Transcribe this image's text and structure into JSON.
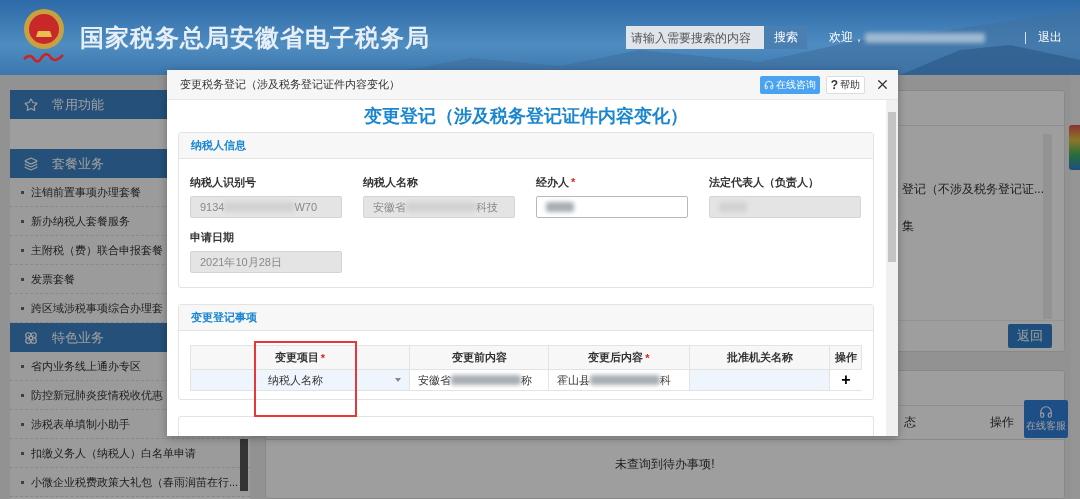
{
  "header": {
    "site_title": "国家税务总局安徽省电子税务局",
    "search": {
      "placeholder": "请输入需要搜索的内容",
      "button": "搜索"
    },
    "welcome": "欢迎，",
    "logout": "退出"
  },
  "sidebar": {
    "sections": [
      {
        "title": "常用功能"
      },
      {
        "title": "套餐业务",
        "items": [
          "注销前置事项办理套餐",
          "新办纳税人套餐服务",
          "主附税（费）联合申报套餐",
          "发票套餐",
          "跨区域涉税事项综合办理套"
        ]
      },
      {
        "title": "特色业务",
        "items": [
          "省内业务线上通办专区",
          "防控新冠肺炎疫情税收优惠",
          "涉税表单填制小助手",
          "扣缴义务人（纳税人）白名单申请",
          "小微企业税费政策大礼包（春雨润苗在行..."
        ]
      }
    ]
  },
  "background": {
    "panel_items": [
      "登记（不涉及税务登记证...",
      "集"
    ],
    "back_button": "返回",
    "table_headers": [
      "态",
      "操作"
    ],
    "empty_message": "未查询到待办事项!"
  },
  "float_button": "在线客服",
  "dialog": {
    "title": "变更税务登记（涉及税务登记证件内容变化）",
    "consult_button": "在线咨询",
    "help_button": {
      "glyph": "?",
      "label": "帮助"
    },
    "heading": "变更登记（涉及税务登记证件内容变化）",
    "required_mark": "*",
    "taxpayer_info": {
      "title": "纳税人信息",
      "fields": [
        {
          "label": "纳税人识别号",
          "required": false,
          "disabled": true,
          "value": [
            {
              "kind": "text",
              "text": "9134"
            },
            {
              "kind": "blur"
            },
            {
              "kind": "text",
              "text": "W70"
            }
          ]
        },
        {
          "label": "纳税人名称",
          "required": false,
          "disabled": true,
          "value": [
            {
              "kind": "text",
              "text": "安徽省"
            },
            {
              "kind": "blur"
            },
            {
              "kind": "text",
              "text": "科技"
            }
          ]
        },
        {
          "label": "经办人",
          "required": true,
          "disabled": false,
          "value": [
            {
              "kind": "blur"
            }
          ]
        },
        {
          "label": "法定代表人（负责人）",
          "required": false,
          "disabled": true,
          "value": [
            {
              "kind": "blur"
            }
          ]
        },
        {
          "label": "申请日期",
          "required": false,
          "disabled": true,
          "value": [
            {
              "kind": "text",
              "text": "2021年10月28日"
            }
          ]
        }
      ]
    },
    "change_items": {
      "title": "变更登记事项",
      "columns": [
        {
          "label": "变更项目",
          "required": true,
          "highlighted": true
        },
        {
          "label": "变更前内容",
          "required": false,
          "highlighted": false
        },
        {
          "label": "变更后内容",
          "required": true,
          "highlighted": false
        },
        {
          "label": "批准机关名称",
          "required": false,
          "highlighted": false
        },
        {
          "label": "操作",
          "required": false,
          "highlighted": false
        }
      ],
      "rows": [
        {
          "item": "纳税人名称",
          "before": [
            {
              "kind": "text",
              "text": "安徽省"
            },
            {
              "kind": "blur"
            },
            {
              "kind": "text",
              "text": "称"
            }
          ],
          "after": [
            {
              "kind": "text",
              "text": "霍山县"
            },
            {
              "kind": "blur"
            },
            {
              "kind": "text",
              "text": "科"
            }
          ],
          "action": "+"
        }
      ]
    }
  }
}
